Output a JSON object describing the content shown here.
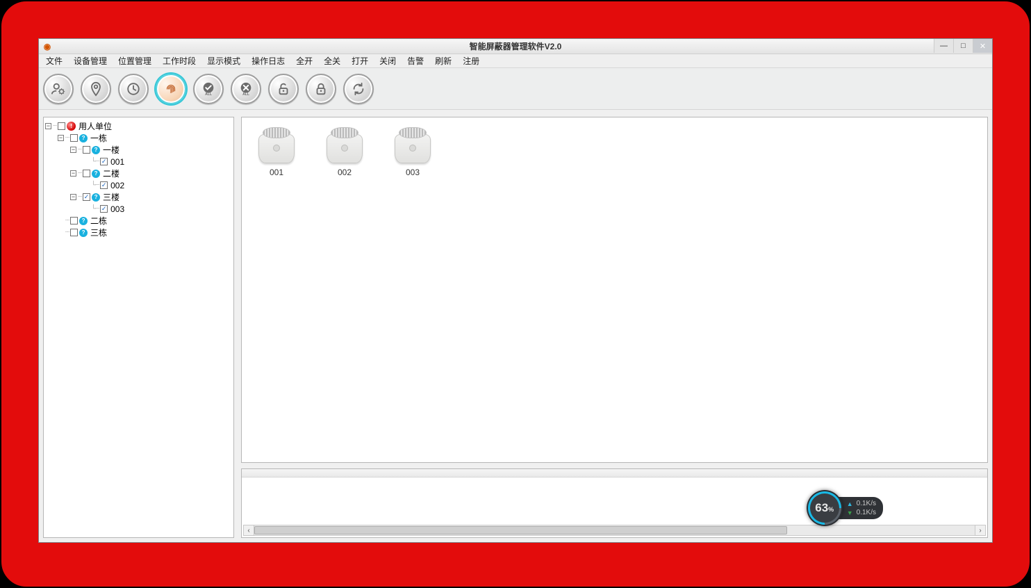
{
  "window": {
    "title": "智能屏蔽器管理软件V2.0"
  },
  "menu": {
    "items": [
      "文件",
      "设备管理",
      "位置管理",
      "工作时段",
      "显示模式",
      "操作日志",
      "全开",
      "全关",
      "打开",
      "关闭",
      "告警",
      "刷新",
      "注册"
    ]
  },
  "toolbar": {
    "buttons": [
      {
        "name": "user-settings",
        "tip": "设备管理"
      },
      {
        "name": "location-pin",
        "tip": "位置管理"
      },
      {
        "name": "clock",
        "tip": "工作时段"
      },
      {
        "name": "fingerprint",
        "tip": "指纹",
        "highlight": true
      },
      {
        "name": "check-all",
        "tip": "全开",
        "sub": "ALL"
      },
      {
        "name": "x-all",
        "tip": "全关",
        "sub": "ALL"
      },
      {
        "name": "unlock",
        "tip": "打开"
      },
      {
        "name": "lock",
        "tip": "关闭"
      },
      {
        "name": "refresh",
        "tip": "刷新"
      }
    ]
  },
  "tree": {
    "root": "用人单位",
    "b1": "一栋",
    "f1": "一楼",
    "d1": "001",
    "f2": "二楼",
    "d2": "002",
    "f3": "三楼",
    "d3": "003",
    "b2": "二栋",
    "b3": "三栋"
  },
  "devices": [
    "001",
    "002",
    "003"
  ],
  "netwidget": {
    "percent": "63",
    "percent_unit": "%",
    "up": "0.1K/s",
    "down": "0.1K/s"
  }
}
